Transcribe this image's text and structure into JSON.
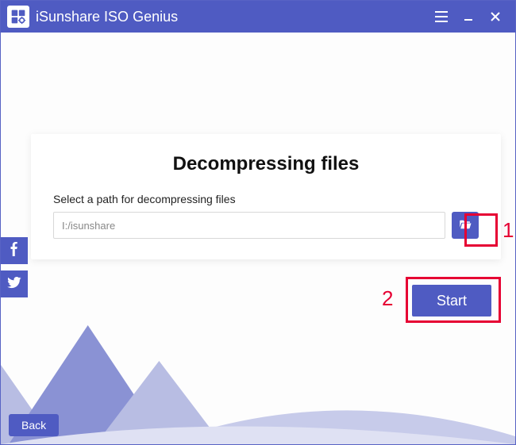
{
  "window": {
    "title": "iSunshare ISO Genius"
  },
  "card": {
    "heading": "Decompressing files",
    "label": "Select a path for decompressing files",
    "path_value": "I:/isunshare"
  },
  "buttons": {
    "start": "Start",
    "back": "Back"
  },
  "annotations": {
    "one": "1",
    "two": "2"
  }
}
